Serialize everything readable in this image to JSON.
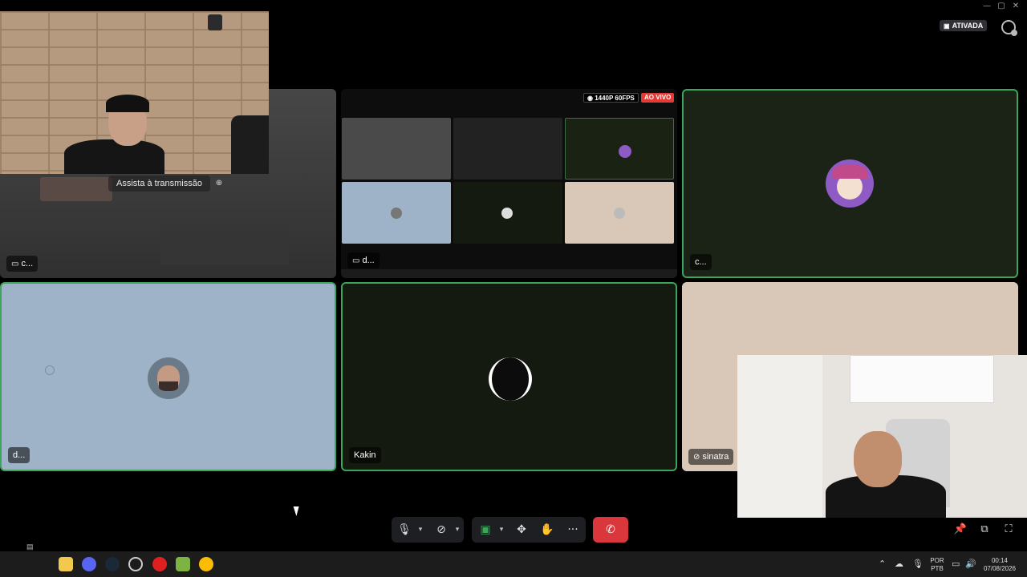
{
  "window": {
    "minimize": "—",
    "maximize": "▢",
    "close": "✕"
  },
  "header": {
    "status_badge": "ATIVADA"
  },
  "overlay": {
    "watch_label": "Assista à transmissão"
  },
  "stream": {
    "quality_badge": "1440P 60FPS",
    "live_badge": "AO VIVO"
  },
  "participants": {
    "tile1_name": "c...",
    "tile2_name": "d...",
    "tile3_name": "c...",
    "tile4_name": "d...",
    "tile5_name": "Kakin",
    "tile6_name": "sinatra"
  },
  "controls": {
    "mic": "microphone-icon",
    "camera": "camera-off-icon",
    "share": "screen-share-icon",
    "activities": "activities-icon",
    "soundboard": "soundboard-icon",
    "more": "···",
    "leave": "hang-up-icon"
  },
  "tray": {
    "lang_top": "POR",
    "lang_bottom": "PTB",
    "time": "00:14",
    "date": "07/08/2026"
  },
  "colors": {
    "speaking": "#3ba55c",
    "leave": "#da373c",
    "live": "#e53935"
  }
}
